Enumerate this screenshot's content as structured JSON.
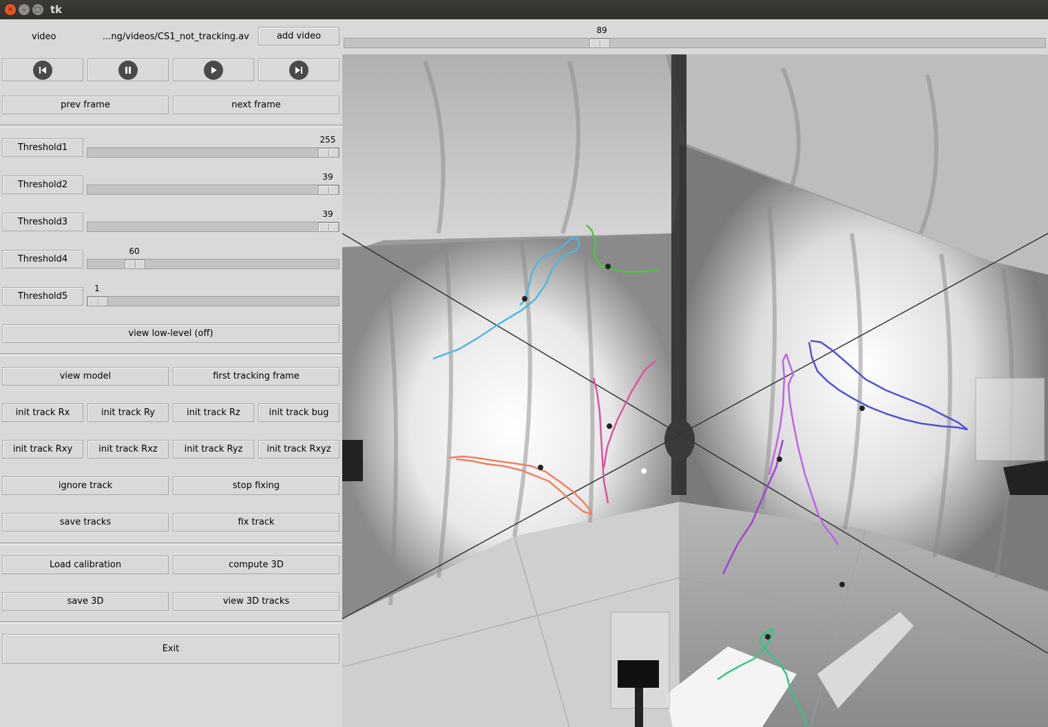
{
  "window": {
    "title": "tk"
  },
  "video": {
    "label": "video",
    "path": "...ng/videos/CS1_not_tracking.av",
    "add_label": "add video",
    "frame_value": "89",
    "frame_fraction": 0.36
  },
  "playback": {
    "prev_frame": "prev frame",
    "next_frame": "next frame"
  },
  "thresholds": [
    {
      "label": "Threshold1",
      "value": "255",
      "fraction": 1.0
    },
    {
      "label": "Threshold2",
      "value": "39",
      "fraction": 1.0
    },
    {
      "label": "Threshold3",
      "value": "39",
      "fraction": 1.0
    },
    {
      "label": "Threshold4",
      "value": "60",
      "fraction": 0.16
    },
    {
      "label": "Threshold5",
      "value": "1",
      "fraction": 0.0
    }
  ],
  "view_lowlevel": "view low-level (off)",
  "tracking": {
    "view_model": "view model",
    "first_tracking_frame": "first tracking frame",
    "init_rx": "init track Rx",
    "init_ry": "init track Ry",
    "init_rz": "init track Rz",
    "init_bug": "init track bug",
    "init_rxy": "init track Rxy",
    "init_rxz": "init track Rxz",
    "init_ryz": "init track Ryz",
    "init_rxyz": "init track Rxyz",
    "ignore": "ignore track",
    "stop_fixing": "stop fixing",
    "save_tracks": "save tracks",
    "fix_track": "fix track"
  },
  "calibration": {
    "load": "Load calibration",
    "compute": "compute 3D",
    "save": "save 3D",
    "view": "view 3D tracks"
  },
  "exit_label": "Exit",
  "track_colors": {
    "cyan": "#4ab8e0",
    "green": "#4cc83c",
    "pink": "#e0509a",
    "orange": "#f08060",
    "violet": "#c060e8",
    "purple": "#a040d0",
    "blue": "#5050d8",
    "teal": "#30c880"
  }
}
